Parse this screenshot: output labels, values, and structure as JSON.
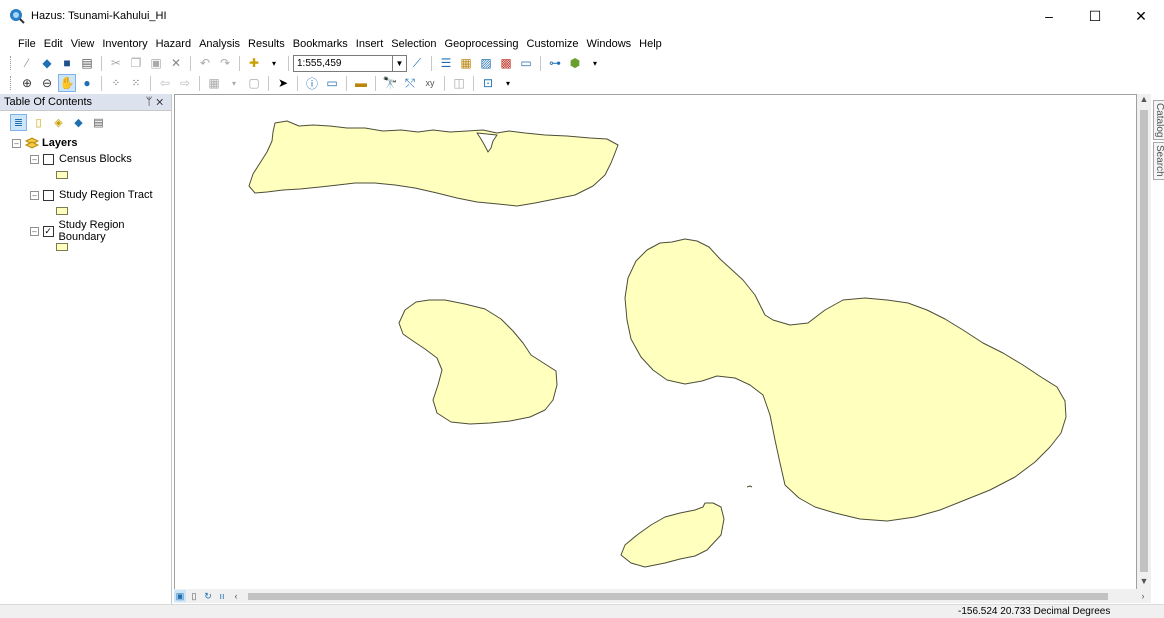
{
  "window": {
    "title": "Hazus: Tsunami-Kahului_HI",
    "minimize": "–",
    "maximize": "☐",
    "close": "✕"
  },
  "menu": [
    "File",
    "Edit",
    "View",
    "Inventory",
    "Hazard",
    "Analysis",
    "Results",
    "Bookmarks",
    "Insert",
    "Selection",
    "Geoprocessing",
    "Customize",
    "Windows",
    "Help"
  ],
  "toolbar": {
    "scale": "1:555,459"
  },
  "toc": {
    "title": "Table Of Contents",
    "pin": "ᛘ",
    "close": "✕",
    "root_label": "Layers",
    "layers": [
      {
        "name": "Census Blocks",
        "checked": false
      },
      {
        "name": "Study Region Tract",
        "checked": false
      },
      {
        "name": "Study Region Boundary",
        "checked": true
      }
    ]
  },
  "sidetabs": [
    "Catalog",
    "Search"
  ],
  "status": {
    "coordinates": "-156.524  20.733 Decimal Degrees"
  },
  "colors": {
    "land_fill": "#ffffbe",
    "land_stroke": "#4d4d3a"
  }
}
